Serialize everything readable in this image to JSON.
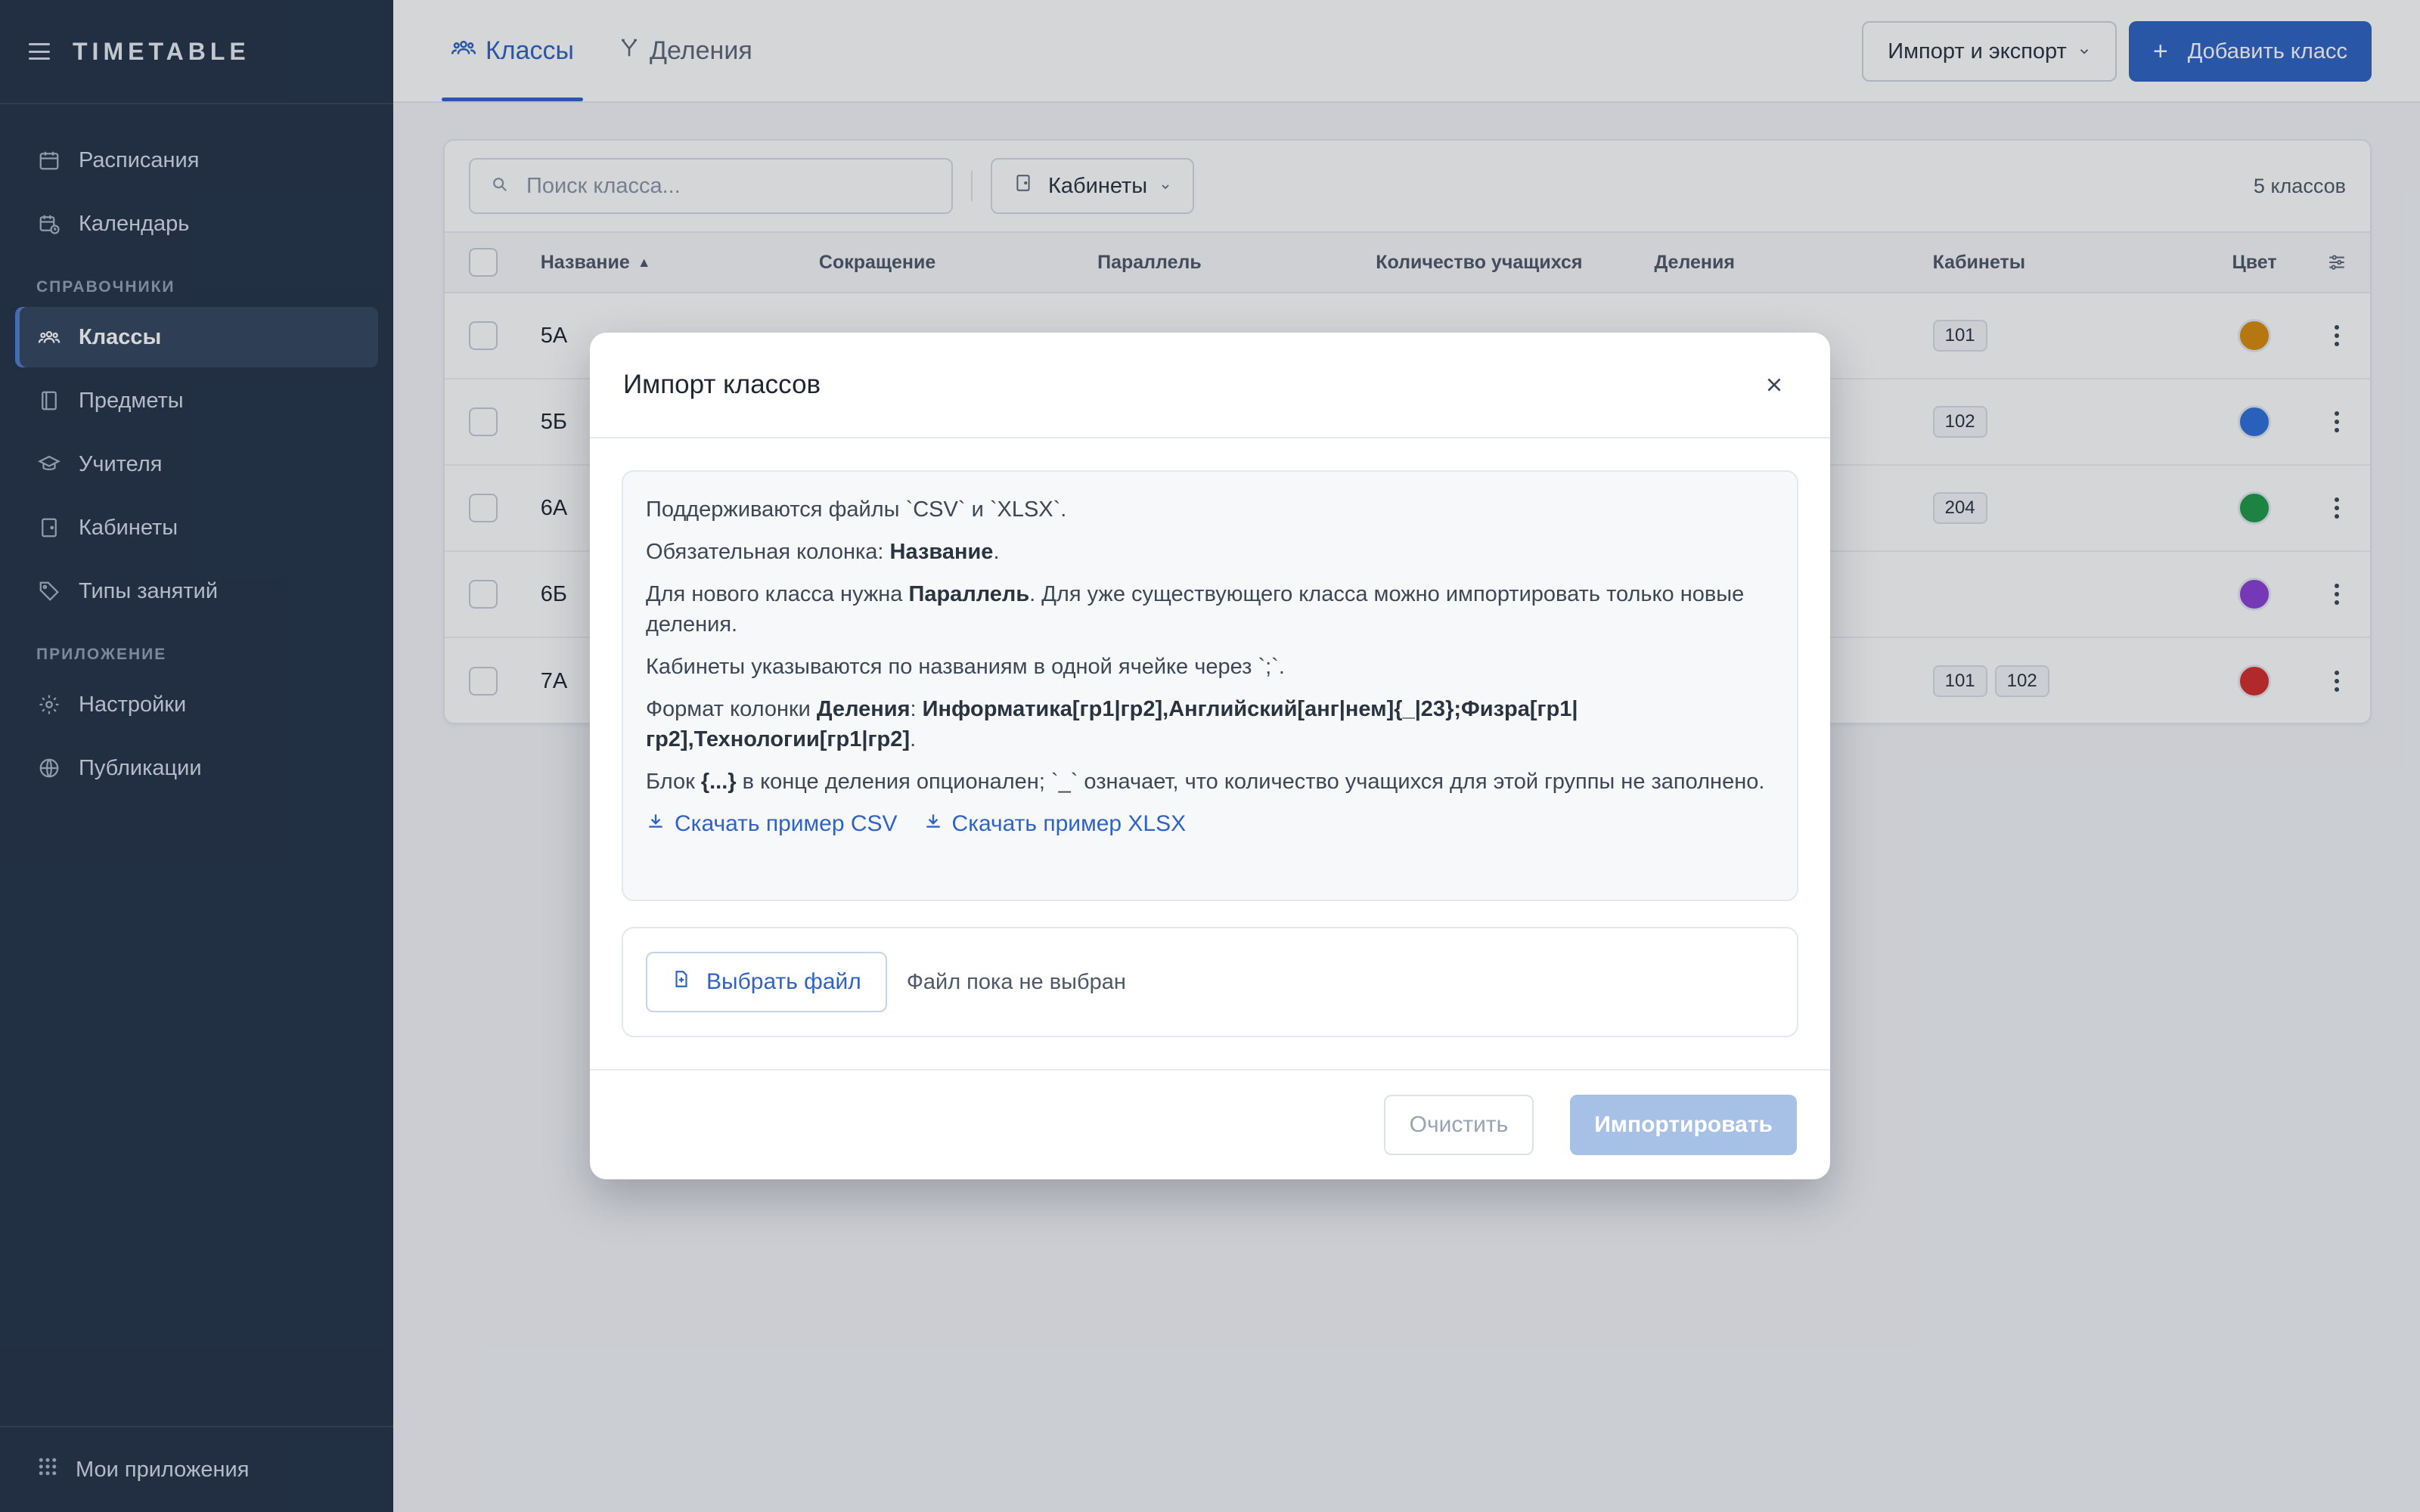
{
  "app": {
    "brand": "TIMETABLE"
  },
  "sidebar": {
    "items_top": [
      {
        "label": "Расписания",
        "icon": "calendar-icon"
      },
      {
        "label": "Календарь",
        "icon": "calendar-clock-icon"
      }
    ],
    "section_refs": "СПРАВОЧНИКИ",
    "items_refs": [
      {
        "label": "Классы",
        "icon": "users-icon",
        "active": true
      },
      {
        "label": "Предметы",
        "icon": "book-icon"
      },
      {
        "label": "Учителя",
        "icon": "graduation-cap-icon"
      },
      {
        "label": "Кабинеты",
        "icon": "door-icon"
      },
      {
        "label": "Типы занятий",
        "icon": "tag-icon"
      }
    ],
    "section_app": "ПРИЛОЖЕНИЕ",
    "items_app": [
      {
        "label": "Настройки",
        "icon": "gear-icon"
      },
      {
        "label": "Публикации",
        "icon": "globe-icon"
      }
    ],
    "footer": "Мои приложения"
  },
  "header": {
    "tabs": [
      {
        "label": "Классы",
        "active": true
      },
      {
        "label": "Деления",
        "active": false
      }
    ],
    "import_export": "Импорт и экспорт",
    "add_class": "Добавить класс"
  },
  "toolbar": {
    "search_placeholder": "Поиск класса...",
    "filter_label": "Кабинеты",
    "count": "5 классов"
  },
  "table": {
    "columns": [
      "Название",
      "Сокращение",
      "Параллель",
      "Количество учащихся",
      "Деления",
      "Кабинеты",
      "Цвет"
    ],
    "rows": [
      {
        "name": "5А",
        "rooms": [
          "101"
        ],
        "color": "#d98a0b"
      },
      {
        "name": "5Б",
        "rooms": [
          "102"
        ],
        "color": "#2e6fdc"
      },
      {
        "name": "6А",
        "rooms": [
          "204"
        ],
        "color": "#1e9a48"
      },
      {
        "name": "6Б",
        "rooms": [],
        "color": "#8b3fd4"
      },
      {
        "name": "7А",
        "rooms": [
          "101",
          "102"
        ],
        "color": "#d42d2d"
      }
    ]
  },
  "modal": {
    "title": "Импорт классов",
    "line1": "Поддерживаются файлы `CSV` и `XLSX`.",
    "line2_prefix": "Обязательная колонка: ",
    "line2_bold": "Название",
    "line2_suffix": ".",
    "line3_prefix": "Для нового класса нужна ",
    "line3_bold": "Параллель",
    "line3_suffix": ". Для уже существующего класса можно импортировать только новые деления.",
    "line4": "Кабинеты указываются по названиям в одной ячейке через `;`.",
    "line5_prefix": "Формат колонки ",
    "line5_bold1": "Деления",
    "line5_colon": ": ",
    "line5_bold2": "Информатика[гр1|гр2],Английский[анг|нем]{_|23};Физра[гр1|гр2],Технологии[гр1|гр2]",
    "line5_suffix": ".",
    "line6_prefix": "Блок ",
    "line6_bold": "{...}",
    "line6_suffix": " в конце деления опционален; `_` означает, что количество учащихся для этой группы не заполнено.",
    "link_csv": "Скачать пример CSV",
    "link_xlsx": "Скачать пример XLSX",
    "choose_file": "Выбрать файл",
    "file_status": "Файл пока не выбран",
    "clear": "Очистить",
    "import": "Импортировать"
  }
}
